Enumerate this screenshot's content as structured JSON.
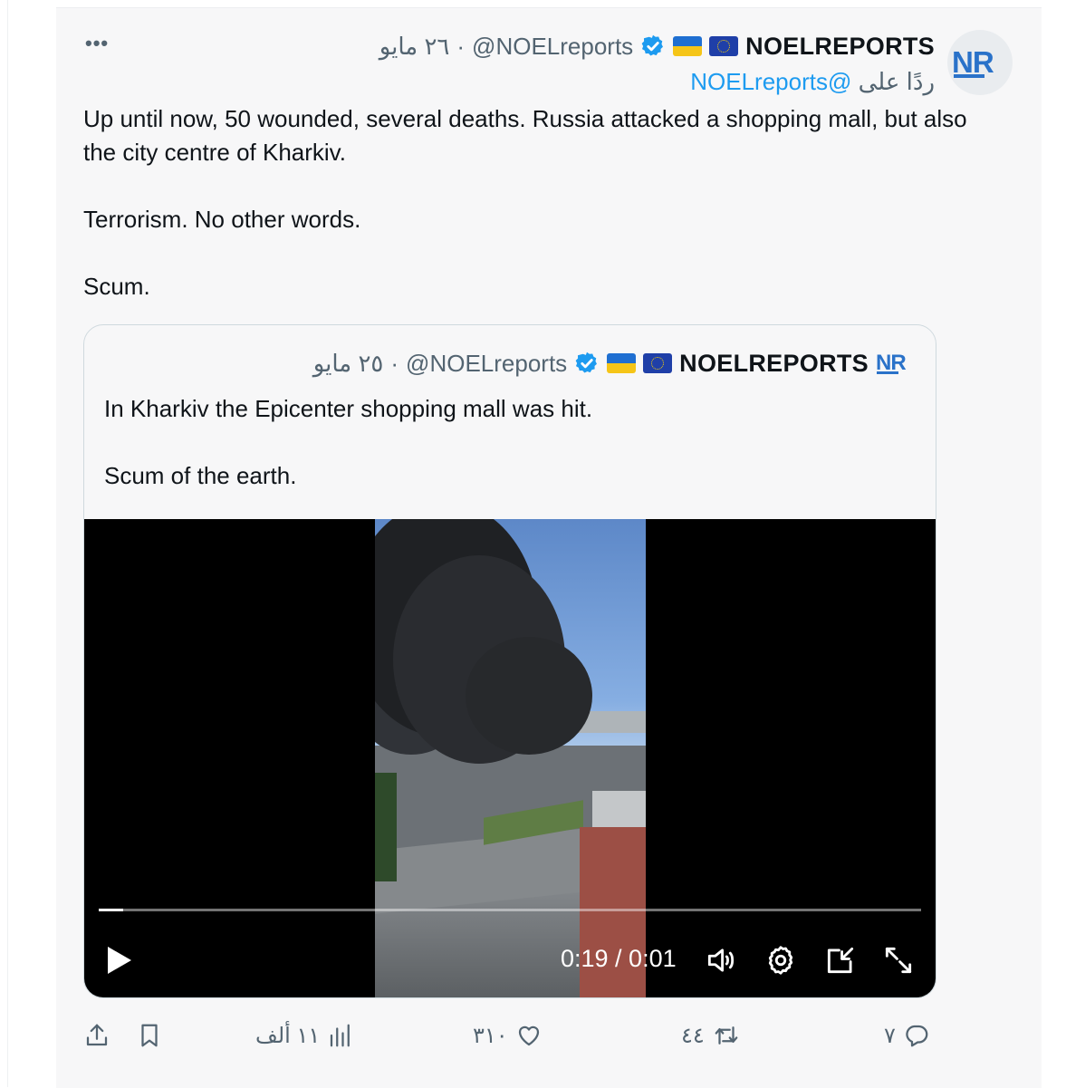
{
  "tweet": {
    "author_name": "NOELREPORTS",
    "handle": "@NOELreports",
    "separator": "·",
    "date": "٢٦ مايو",
    "reply_prefix": "ردًا على",
    "reply_handle": "@NOELreports",
    "avatar_logo": "NR",
    "text": "Up until now, 50 wounded, several deaths. Russia attacked a shopping mall, but also the city centre of Kharkiv.\n\nTerrorism. No other words.\n\nScum.",
    "flags": [
      "ukraine-flag-icon",
      "eu-flag-icon"
    ]
  },
  "quote": {
    "author_name": "NOELREPORTS",
    "handle": "@NOELreports",
    "separator": "·",
    "date": "٢٥ مايو",
    "avatar_logo": "NR",
    "text": "In Kharkiv the Epicenter shopping mall was hit.\n\nScum of the earth."
  },
  "video": {
    "time": "0:19 / 0:01",
    "progress": 0.03
  },
  "actions": {
    "replies": "٧",
    "reposts": "٤٤",
    "likes": "٣١٠",
    "views": "١١ ألف"
  },
  "colors": {
    "accent": "#1d9bf0",
    "muted": "#536471",
    "logo_blue": "#2a72c9"
  }
}
